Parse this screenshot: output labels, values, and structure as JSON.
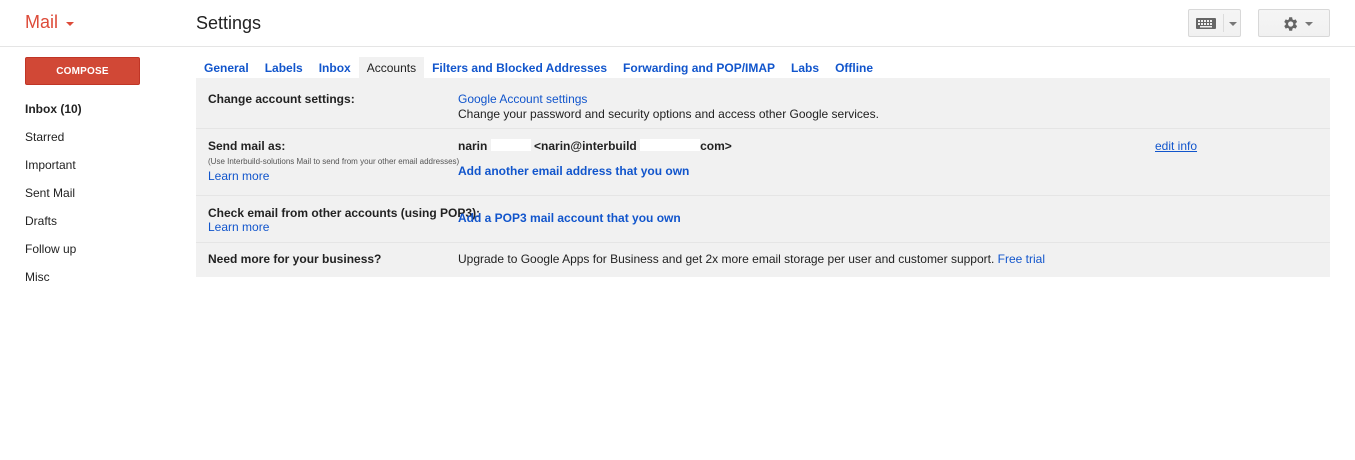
{
  "header": {
    "app_name": "Mail",
    "page_title": "Settings",
    "keyboard_icon": "keyboard-icon",
    "settings_icon": "gear-icon"
  },
  "sidebar": {
    "compose_label": "COMPOSE",
    "items": [
      {
        "label": "Inbox (10)",
        "bold": true
      },
      {
        "label": "Starred"
      },
      {
        "label": "Important"
      },
      {
        "label": "Sent Mail"
      },
      {
        "label": "Drafts"
      },
      {
        "label": "Follow up"
      },
      {
        "label": "Misc"
      }
    ]
  },
  "tabs": [
    {
      "label": "General"
    },
    {
      "label": "Labels"
    },
    {
      "label": "Inbox"
    },
    {
      "label": "Accounts",
      "active": true
    },
    {
      "label": "Filters and Blocked Addresses"
    },
    {
      "label": "Forwarding and POP/IMAP"
    },
    {
      "label": "Labs"
    },
    {
      "label": "Offline"
    }
  ],
  "settings": {
    "change_account": {
      "label": "Change account settings:",
      "link": "Google Account settings",
      "description": "Change your password and security options and access other Google services."
    },
    "send_mail_as": {
      "label": "Send mail as:",
      "sublabel": "(Use Interbuild-solutions Mail to send from your other email addresses)",
      "learn_more": "Learn more",
      "name_part": "narin",
      "email_part1": "<narin@interbuild",
      "email_part2": "com>",
      "edit_info": "edit info",
      "add_address": "Add another email address that you own"
    },
    "check_email": {
      "label": "Check email from other accounts (using POP3):",
      "learn_more": "Learn more",
      "add_pop3": "Add a POP3 mail account that you own"
    },
    "business": {
      "label": "Need more for your business?",
      "text": "Upgrade to Google Apps for Business and get 2x more email storage per user and customer support.",
      "free_trial": "Free trial"
    }
  },
  "colors": {
    "brand_red": "#dd4b39",
    "compose_red": "#d14836",
    "link_blue": "#1155cc",
    "panel_bg": "#f1f1f1"
  }
}
